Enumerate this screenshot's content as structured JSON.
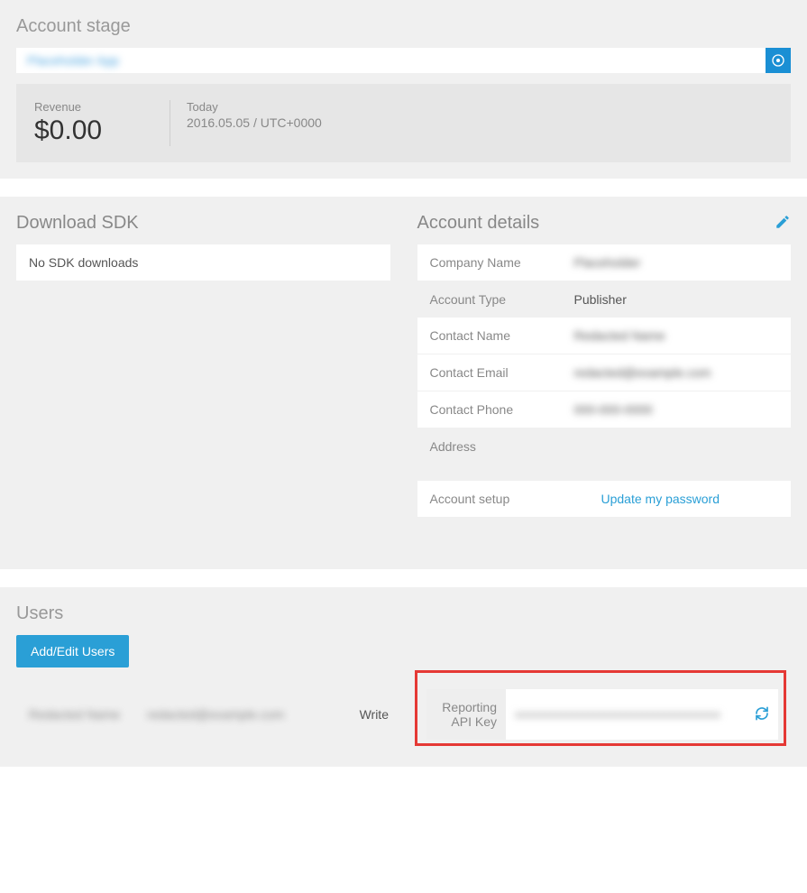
{
  "account_stage": {
    "title": "Account stage",
    "app_name": "Placeholder App",
    "revenue_label": "Revenue",
    "revenue_value": "$0.00",
    "today_label": "Today",
    "today_value": "2016.05.05 / UTC+0000"
  },
  "download_sdk": {
    "title": "Download SDK",
    "empty_text": "No SDK downloads"
  },
  "account_details": {
    "title": "Account details",
    "rows": [
      {
        "label": "Company Name",
        "value": "Placeholder"
      },
      {
        "label": "Account Type",
        "value": "Publisher"
      },
      {
        "label": "Contact Name",
        "value": "Redacted Name"
      },
      {
        "label": "Contact Email",
        "value": "redacted@example.com"
      },
      {
        "label": "Contact Phone",
        "value": "000-000-0000"
      }
    ],
    "address_label": "Address",
    "setup_label": "Account setup",
    "update_password": "Update my password"
  },
  "users": {
    "title": "Users",
    "add_edit_button": "Add/Edit Users",
    "row": {
      "name": "Redacted Name",
      "email": "redacted@example.com",
      "permission": "Write"
    },
    "api_key_label": "Reporting API Key",
    "api_key_value": "xxxxxxxxxxxxxxxxxxxxxxxxxxxxxxxxxxxxxx"
  }
}
